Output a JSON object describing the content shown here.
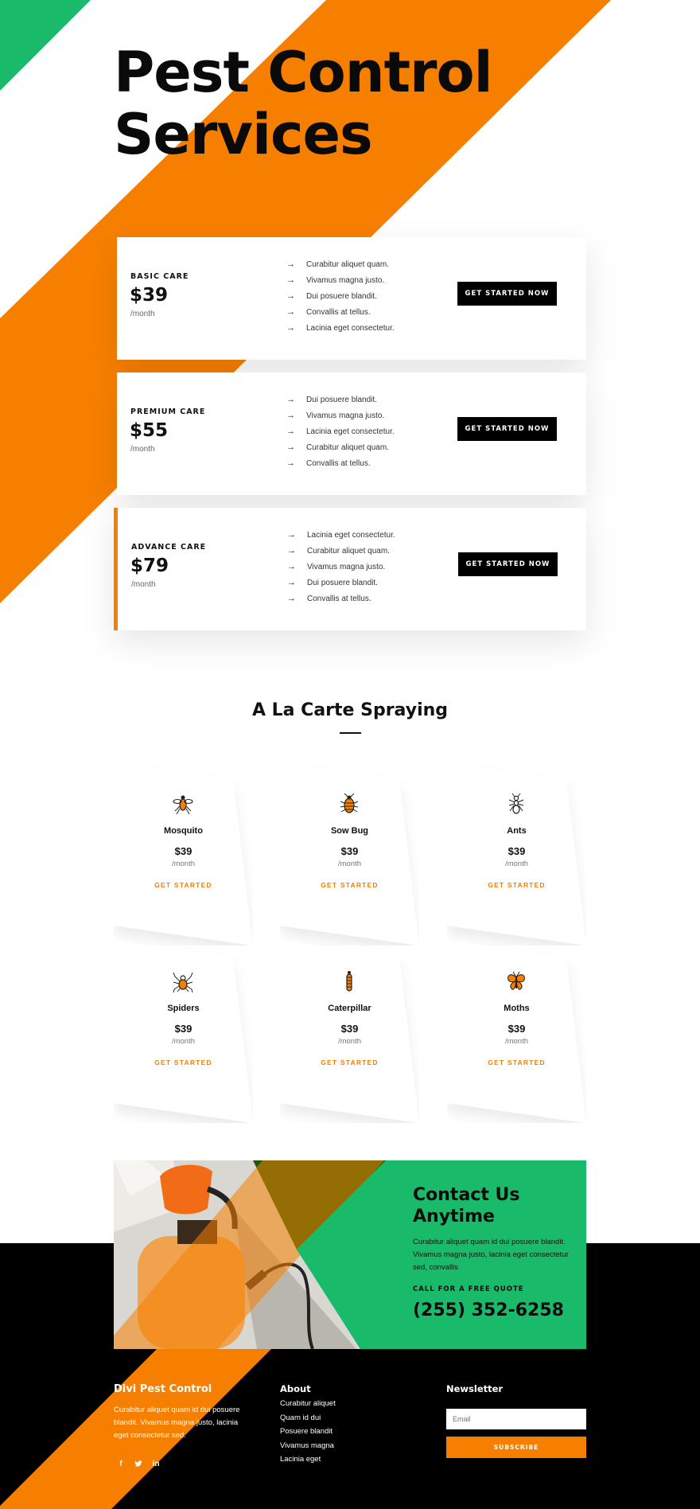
{
  "colors": {
    "orange": "#f77f00",
    "green": "#19bb6a",
    "dark_green": "#1b5a0c",
    "black": "#000000"
  },
  "hero": {
    "title_line1": "Pest Control",
    "title_line2": "Services"
  },
  "plans": [
    {
      "name": "BASIC CARE",
      "price": "$39",
      "per": "/month",
      "button": "GET STARTED NOW",
      "features": [
        "Curabitur aliquet quam.",
        "Vivamus magna justo.",
        "Dui posuere blandit.",
        "Convallis at tellus.",
        "Lacinia eget consectetur."
      ]
    },
    {
      "name": "PREMIUM CARE",
      "price": "$55",
      "per": "/month",
      "button": "GET STARTED NOW",
      "features": [
        "Dui posuere blandit.",
        "Vivamus magna justo.",
        "Lacinia eget consectetur.",
        "Curabitur aliquet quam.",
        "Convallis at tellus."
      ]
    },
    {
      "name": "ADVANCE CARE",
      "price": "$79",
      "per": "/month",
      "button": "GET STARTED NOW",
      "features": [
        "Lacinia eget consectetur.",
        "Curabitur aliquet quam.",
        "Vivamus magna justo.",
        "Dui posuere blandit.",
        "Convallis at tellus."
      ]
    }
  ],
  "feature_arrow": "→",
  "alacarte": {
    "title": "A La Carte Spraying",
    "items": [
      {
        "name": "Mosquito",
        "price": "$39",
        "per": "/month",
        "link": "GET STARTED",
        "icon": "mosquito-icon"
      },
      {
        "name": "Sow Bug",
        "price": "$39",
        "per": "/month",
        "link": "GET STARTED",
        "icon": "sow-bug-icon"
      },
      {
        "name": "Ants",
        "price": "$39",
        "per": "/month",
        "link": "GET STARTED",
        "icon": "ant-icon"
      },
      {
        "name": "Spiders",
        "price": "$39",
        "per": "/month",
        "link": "GET STARTED",
        "icon": "spider-icon"
      },
      {
        "name": "Caterpillar",
        "price": "$39",
        "per": "/month",
        "link": "GET STARTED",
        "icon": "caterpillar-icon"
      },
      {
        "name": "Moths",
        "price": "$39",
        "per": "/month",
        "link": "GET STARTED",
        "icon": "moth-icon"
      }
    ]
  },
  "contact": {
    "title_line1": "Contact Us",
    "title_line2": "Anytime",
    "text": "Curabitur aliquet quam id dui posuere blandit. Vivamus magna justo, lacinia eget consectetur sed, convallis",
    "subhead": "CALL FOR A FREE QUOTE",
    "phone": "(255) 352-6258"
  },
  "footer": {
    "brand": "Divi Pest Control",
    "text": "Curabitur aliquet quam id dui posuere blandit. Vivamus magna justo, lacinia eget consectetur sed.",
    "social": [
      "f",
      "t",
      "in"
    ],
    "about_title": "About",
    "about_links": [
      "Curabitur aliquet",
      "Quam id dui",
      "Posuere blandit",
      "Vivamus magna",
      "Lacinia eget"
    ],
    "newsletter_title": "Newsletter",
    "email_placeholder": "Email",
    "subscribe": "SUBSCRIBE"
  }
}
